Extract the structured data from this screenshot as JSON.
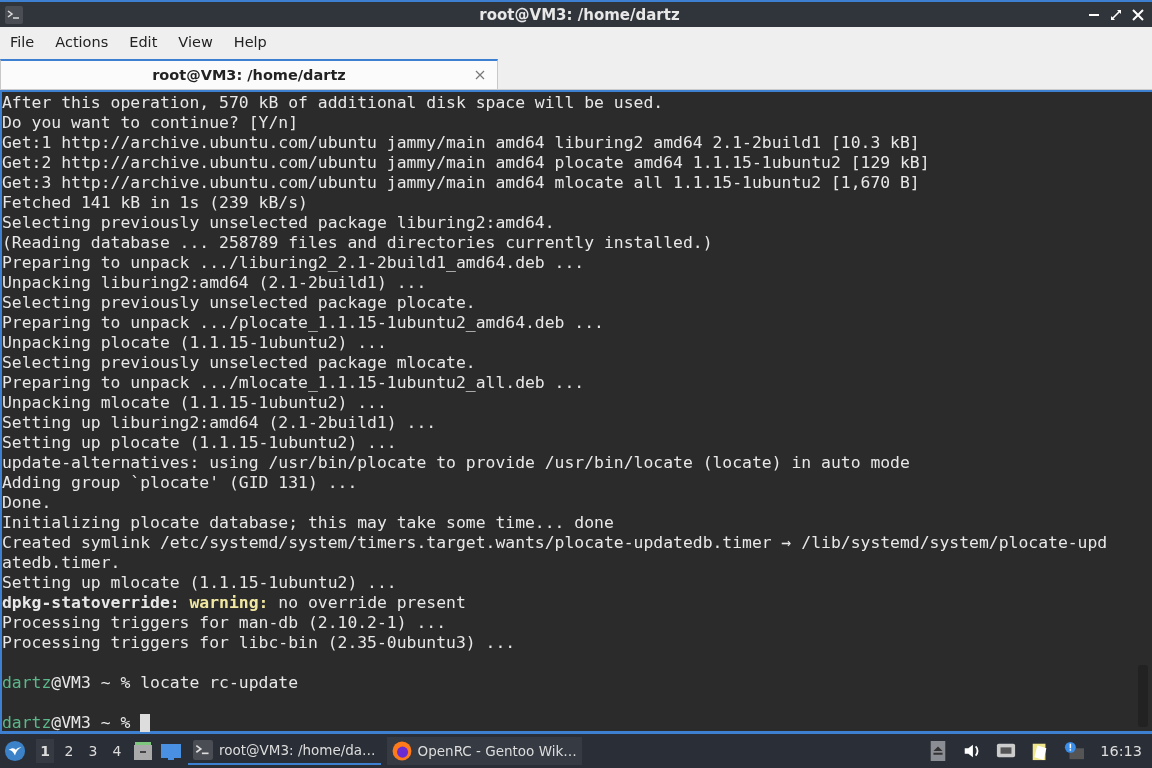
{
  "window": {
    "title": "root@VM3: /home/dartz"
  },
  "menu": [
    "File",
    "Actions",
    "Edit",
    "View",
    "Help"
  ],
  "tabs": [
    {
      "label": "root@VM3: /home/dartz",
      "selected": true
    }
  ],
  "terminal": {
    "lines": [
      {
        "kind": "text",
        "segments": [
          {
            "kind": "plain",
            "text": "After this operation, 570 kB of additional disk space will be used."
          }
        ]
      },
      {
        "kind": "text",
        "segments": [
          {
            "kind": "plain",
            "text": "Do you want to continue? [Y/n]"
          }
        ]
      },
      {
        "kind": "text",
        "segments": [
          {
            "kind": "plain",
            "text": "Get:1 http://archive.ubuntu.com/ubuntu jammy/main amd64 liburing2 amd64 2.1-2build1 [10.3 kB]"
          }
        ]
      },
      {
        "kind": "text",
        "segments": [
          {
            "kind": "plain",
            "text": "Get:2 http://archive.ubuntu.com/ubuntu jammy/main amd64 plocate amd64 1.1.15-1ubuntu2 [129 kB]"
          }
        ]
      },
      {
        "kind": "text",
        "segments": [
          {
            "kind": "plain",
            "text": "Get:3 http://archive.ubuntu.com/ubuntu jammy/main amd64 mlocate all 1.1.15-1ubuntu2 [1,670 B]"
          }
        ]
      },
      {
        "kind": "text",
        "segments": [
          {
            "kind": "plain",
            "text": "Fetched 141 kB in 1s (239 kB/s)"
          }
        ]
      },
      {
        "kind": "text",
        "segments": [
          {
            "kind": "plain",
            "text": "Selecting previously unselected package liburing2:amd64."
          }
        ]
      },
      {
        "kind": "text",
        "segments": [
          {
            "kind": "plain",
            "text": "(Reading database ... 258789 files and directories currently installed.)"
          }
        ]
      },
      {
        "kind": "text",
        "segments": [
          {
            "kind": "plain",
            "text": "Preparing to unpack .../liburing2_2.1-2build1_amd64.deb ..."
          }
        ]
      },
      {
        "kind": "text",
        "segments": [
          {
            "kind": "plain",
            "text": "Unpacking liburing2:amd64 (2.1-2build1) ..."
          }
        ]
      },
      {
        "kind": "text",
        "segments": [
          {
            "kind": "plain",
            "text": "Selecting previously unselected package plocate."
          }
        ]
      },
      {
        "kind": "text",
        "segments": [
          {
            "kind": "plain",
            "text": "Preparing to unpack .../plocate_1.1.15-1ubuntu2_amd64.deb ..."
          }
        ]
      },
      {
        "kind": "text",
        "segments": [
          {
            "kind": "plain",
            "text": "Unpacking plocate (1.1.15-1ubuntu2) ..."
          }
        ]
      },
      {
        "kind": "text",
        "segments": [
          {
            "kind": "plain",
            "text": "Selecting previously unselected package mlocate."
          }
        ]
      },
      {
        "kind": "text",
        "segments": [
          {
            "kind": "plain",
            "text": "Preparing to unpack .../mlocate_1.1.15-1ubuntu2_all.deb ..."
          }
        ]
      },
      {
        "kind": "text",
        "segments": [
          {
            "kind": "plain",
            "text": "Unpacking mlocate (1.1.15-1ubuntu2) ..."
          }
        ]
      },
      {
        "kind": "text",
        "segments": [
          {
            "kind": "plain",
            "text": "Setting up liburing2:amd64 (2.1-2build1) ..."
          }
        ]
      },
      {
        "kind": "text",
        "segments": [
          {
            "kind": "plain",
            "text": "Setting up plocate (1.1.15-1ubuntu2) ..."
          }
        ]
      },
      {
        "kind": "text",
        "segments": [
          {
            "kind": "plain",
            "text": "update-alternatives: using /usr/bin/plocate to provide /usr/bin/locate (locate) in auto mode"
          }
        ]
      },
      {
        "kind": "text",
        "segments": [
          {
            "kind": "plain",
            "text": "Adding group `plocate' (GID 131) ..."
          }
        ]
      },
      {
        "kind": "text",
        "segments": [
          {
            "kind": "plain",
            "text": "Done."
          }
        ]
      },
      {
        "kind": "text",
        "segments": [
          {
            "kind": "plain",
            "text": "Initializing plocate database; this may take some time... done"
          }
        ]
      },
      {
        "kind": "text",
        "segments": [
          {
            "kind": "plain",
            "text": "Created symlink /etc/systemd/system/timers.target.wants/plocate-updatedb.timer → /lib/systemd/system/plocate-upd"
          }
        ]
      },
      {
        "kind": "text",
        "segments": [
          {
            "kind": "plain",
            "text": "atedb.timer."
          }
        ]
      },
      {
        "kind": "text",
        "segments": [
          {
            "kind": "plain",
            "text": "Setting up mlocate (1.1.15-1ubuntu2) ..."
          }
        ]
      },
      {
        "kind": "text",
        "segments": [
          {
            "kind": "bold",
            "text": "dpkg-statoverride:"
          },
          {
            "kind": "warning",
            "text": "warning:"
          },
          {
            "kind": "plain",
            "text": "no override present"
          }
        ]
      },
      {
        "kind": "text",
        "segments": [
          {
            "kind": "plain",
            "text": "Processing triggers for man-db (2.10.2-1) ..."
          }
        ]
      },
      {
        "kind": "text",
        "segments": [
          {
            "kind": "plain",
            "text": "Processing triggers for libc-bin (2.35-0ubuntu3) ..."
          }
        ]
      },
      {
        "kind": "blank"
      },
      {
        "kind": "text",
        "segments": [
          {
            "kind": "user",
            "text": "dartz"
          },
          {
            "kind": "plain",
            "text": "@VM3 ~ % locate rc-update"
          }
        ]
      },
      {
        "kind": "blank"
      },
      {
        "kind": "text",
        "cursor": true,
        "segments": [
          {
            "kind": "user",
            "text": "dartz"
          },
          {
            "kind": "plain",
            "text": "@VM3 ~ %"
          }
        ]
      }
    ]
  },
  "taskbar": {
    "workspaces": [
      {
        "label": "1",
        "selected": true
      },
      {
        "label": "2",
        "selected": false
      },
      {
        "label": "3",
        "selected": false
      },
      {
        "label": "4",
        "selected": false
      }
    ],
    "tasks": [
      {
        "kind": "terminal",
        "label": "root@VM3: /home/da…",
        "selected": true
      },
      {
        "kind": "browser",
        "label": "OpenRC - Gentoo Wik…",
        "selected": false
      }
    ],
    "clock": "16:13"
  }
}
